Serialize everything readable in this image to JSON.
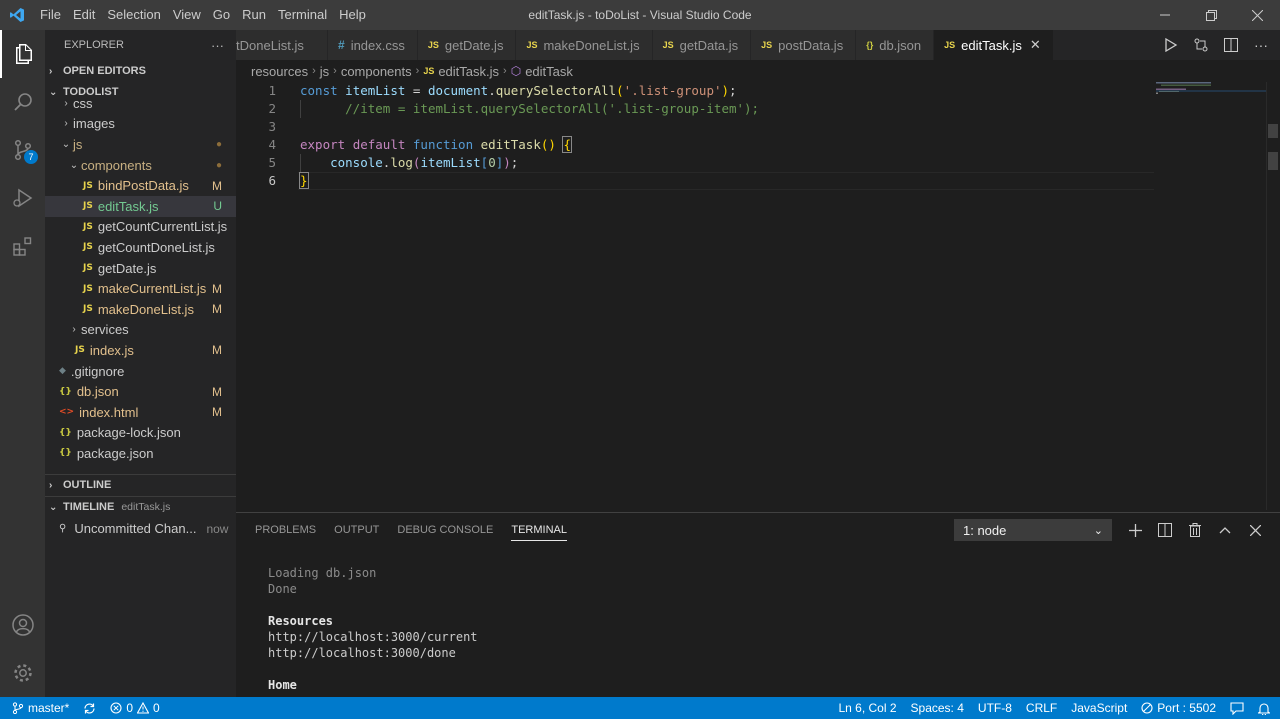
{
  "window": {
    "title": "editTask.js - toDoList - Visual Studio Code",
    "menu": [
      "File",
      "Edit",
      "Selection",
      "View",
      "Go",
      "Run",
      "Terminal",
      "Help"
    ]
  },
  "activity": {
    "scm_badge": "7",
    "icons": [
      "files-icon",
      "search-icon",
      "source-control-icon",
      "run-debug-icon",
      "extensions-icon",
      "account-icon",
      "settings-gear-icon"
    ]
  },
  "sidebar": {
    "header": "EXPLORER",
    "more": "···",
    "open_editors": "OPEN EDITORS",
    "project": "TODOLIST",
    "tree": [
      {
        "label": "css",
        "type": "folder",
        "indent": 1,
        "chev": "›",
        "status": ""
      },
      {
        "label": "images",
        "type": "folder",
        "indent": 1,
        "chev": "›",
        "status": ""
      },
      {
        "label": "js",
        "type": "folder",
        "indent": 1,
        "chev": "⌄",
        "status": "●"
      },
      {
        "label": "components",
        "type": "folder",
        "indent": 2,
        "chev": "⌄",
        "status": "●"
      },
      {
        "label": "bindPostData.js",
        "type": "js",
        "indent": 3,
        "status": "M"
      },
      {
        "label": "editTask.js",
        "type": "js",
        "indent": 3,
        "status": "U"
      },
      {
        "label": "getCountCurrentList.js",
        "type": "js",
        "indent": 3,
        "status": ""
      },
      {
        "label": "getCountDoneList.js",
        "type": "js",
        "indent": 3,
        "status": ""
      },
      {
        "label": "getDate.js",
        "type": "js",
        "indent": 3,
        "status": ""
      },
      {
        "label": "makeCurrentList.js",
        "type": "js",
        "indent": 3,
        "status": "M"
      },
      {
        "label": "makeDoneList.js",
        "type": "js",
        "indent": 3,
        "status": "M"
      },
      {
        "label": "services",
        "type": "folder",
        "indent": 2,
        "chev": "›",
        "status": ""
      },
      {
        "label": "index.js",
        "type": "js",
        "indent": 2,
        "status": "M"
      },
      {
        "label": ".gitignore",
        "type": "git",
        "indent": 1,
        "status": ""
      },
      {
        "label": "db.json",
        "type": "json",
        "indent": 1,
        "status": "M"
      },
      {
        "label": "index.html",
        "type": "html",
        "indent": 1,
        "status": "M"
      },
      {
        "label": "package-lock.json",
        "type": "json",
        "indent": 1,
        "status": ""
      },
      {
        "label": "package.json",
        "type": "json",
        "indent": 1,
        "status": ""
      }
    ],
    "outline": "OUTLINE",
    "timeline": "TIMELINE",
    "timeline_file": "editTask.js",
    "timeline_item": "Uncommitted Chan...",
    "timeline_when": "now"
  },
  "tabs": [
    {
      "label": "tDoneList.js",
      "icon": "",
      "active": false
    },
    {
      "label": "index.css",
      "icon": "#",
      "active": false
    },
    {
      "label": "getDate.js",
      "icon": "JS",
      "active": false
    },
    {
      "label": "makeDoneList.js",
      "icon": "JS",
      "active": false
    },
    {
      "label": "getData.js",
      "icon": "JS",
      "active": false
    },
    {
      "label": "postData.js",
      "icon": "JS",
      "active": false
    },
    {
      "label": "db.json",
      "icon": "{}",
      "active": false
    },
    {
      "label": "editTask.js",
      "icon": "JS",
      "active": true
    }
  ],
  "breadcrumb": [
    "resources",
    "js",
    "components",
    "editTask.js",
    "editTask"
  ],
  "editor": {
    "line_numbers": [
      "1",
      "2",
      "3",
      "4",
      "5",
      "6"
    ]
  },
  "panel": {
    "tabs": [
      "PROBLEMS",
      "OUTPUT",
      "DEBUG CONSOLE",
      "TERMINAL"
    ],
    "active_tab": "TERMINAL",
    "terminal_select": "1: node",
    "terminal_lines": [
      {
        "text": "Loading db.json",
        "style": "dim"
      },
      {
        "text": "Done",
        "style": "dim"
      },
      {
        "text": "",
        "style": ""
      },
      {
        "text": "Resources",
        "style": "bold"
      },
      {
        "text": "http://localhost:3000/current",
        "style": ""
      },
      {
        "text": "http://localhost:3000/done",
        "style": ""
      },
      {
        "text": "",
        "style": ""
      },
      {
        "text": "Home",
        "style": "bold"
      }
    ]
  },
  "status": {
    "branch": "master*",
    "errors": "0",
    "warnings": "0",
    "position": "Ln 6, Col 2",
    "spaces": "Spaces: 4",
    "encoding": "UTF-8",
    "eol": "CRLF",
    "language": "JavaScript",
    "port": "Port : 5502"
  },
  "colors": {
    "accent": "#007acc",
    "modified": "#e2c08d",
    "untracked": "#73c991"
  }
}
